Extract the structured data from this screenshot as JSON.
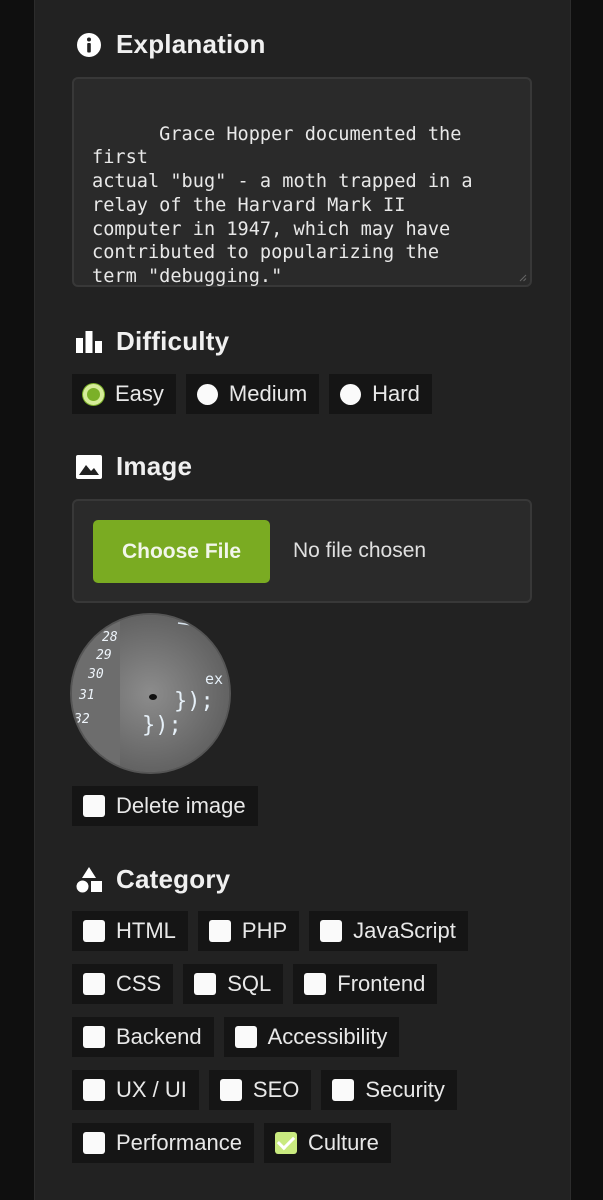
{
  "explanation": {
    "heading": "Explanation",
    "text": "Grace Hopper documented the first\nactual \"bug\" - a moth trapped in a\nrelay of the Harvard Mark II\ncomputer in 1947, which may have\ncontributed to popularizing the\nterm \"debugging.\""
  },
  "difficulty": {
    "heading": "Difficulty",
    "options": [
      {
        "label": "Easy",
        "checked": true
      },
      {
        "label": "Medium",
        "checked": false
      },
      {
        "label": "Hard",
        "checked": false
      }
    ]
  },
  "image": {
    "heading": "Image",
    "choose_label": "Choose File",
    "status": "No file chosen",
    "delete_label": "Delete image",
    "preview_lines": [
      "28",
      "29",
      "30",
      "31",
      "32"
    ]
  },
  "category": {
    "heading": "Category",
    "rows": [
      [
        {
          "label": "HTML",
          "checked": false
        },
        {
          "label": "PHP",
          "checked": false
        },
        {
          "label": "JavaScript",
          "checked": false
        }
      ],
      [
        {
          "label": "CSS",
          "checked": false
        },
        {
          "label": "SQL",
          "checked": false
        },
        {
          "label": "Frontend",
          "checked": false
        }
      ],
      [
        {
          "label": "Backend",
          "checked": false
        },
        {
          "label": "Accessibility",
          "checked": false
        }
      ],
      [
        {
          "label": "UX / UI",
          "checked": false
        },
        {
          "label": "SEO",
          "checked": false
        },
        {
          "label": "Security",
          "checked": false
        }
      ],
      [
        {
          "label": "Performance",
          "checked": false
        },
        {
          "label": "Culture",
          "checked": true
        }
      ]
    ]
  },
  "colors": {
    "accent": "#7aab22",
    "panel": "#222222",
    "field": "#2a2a2a",
    "chip": "#151515"
  }
}
